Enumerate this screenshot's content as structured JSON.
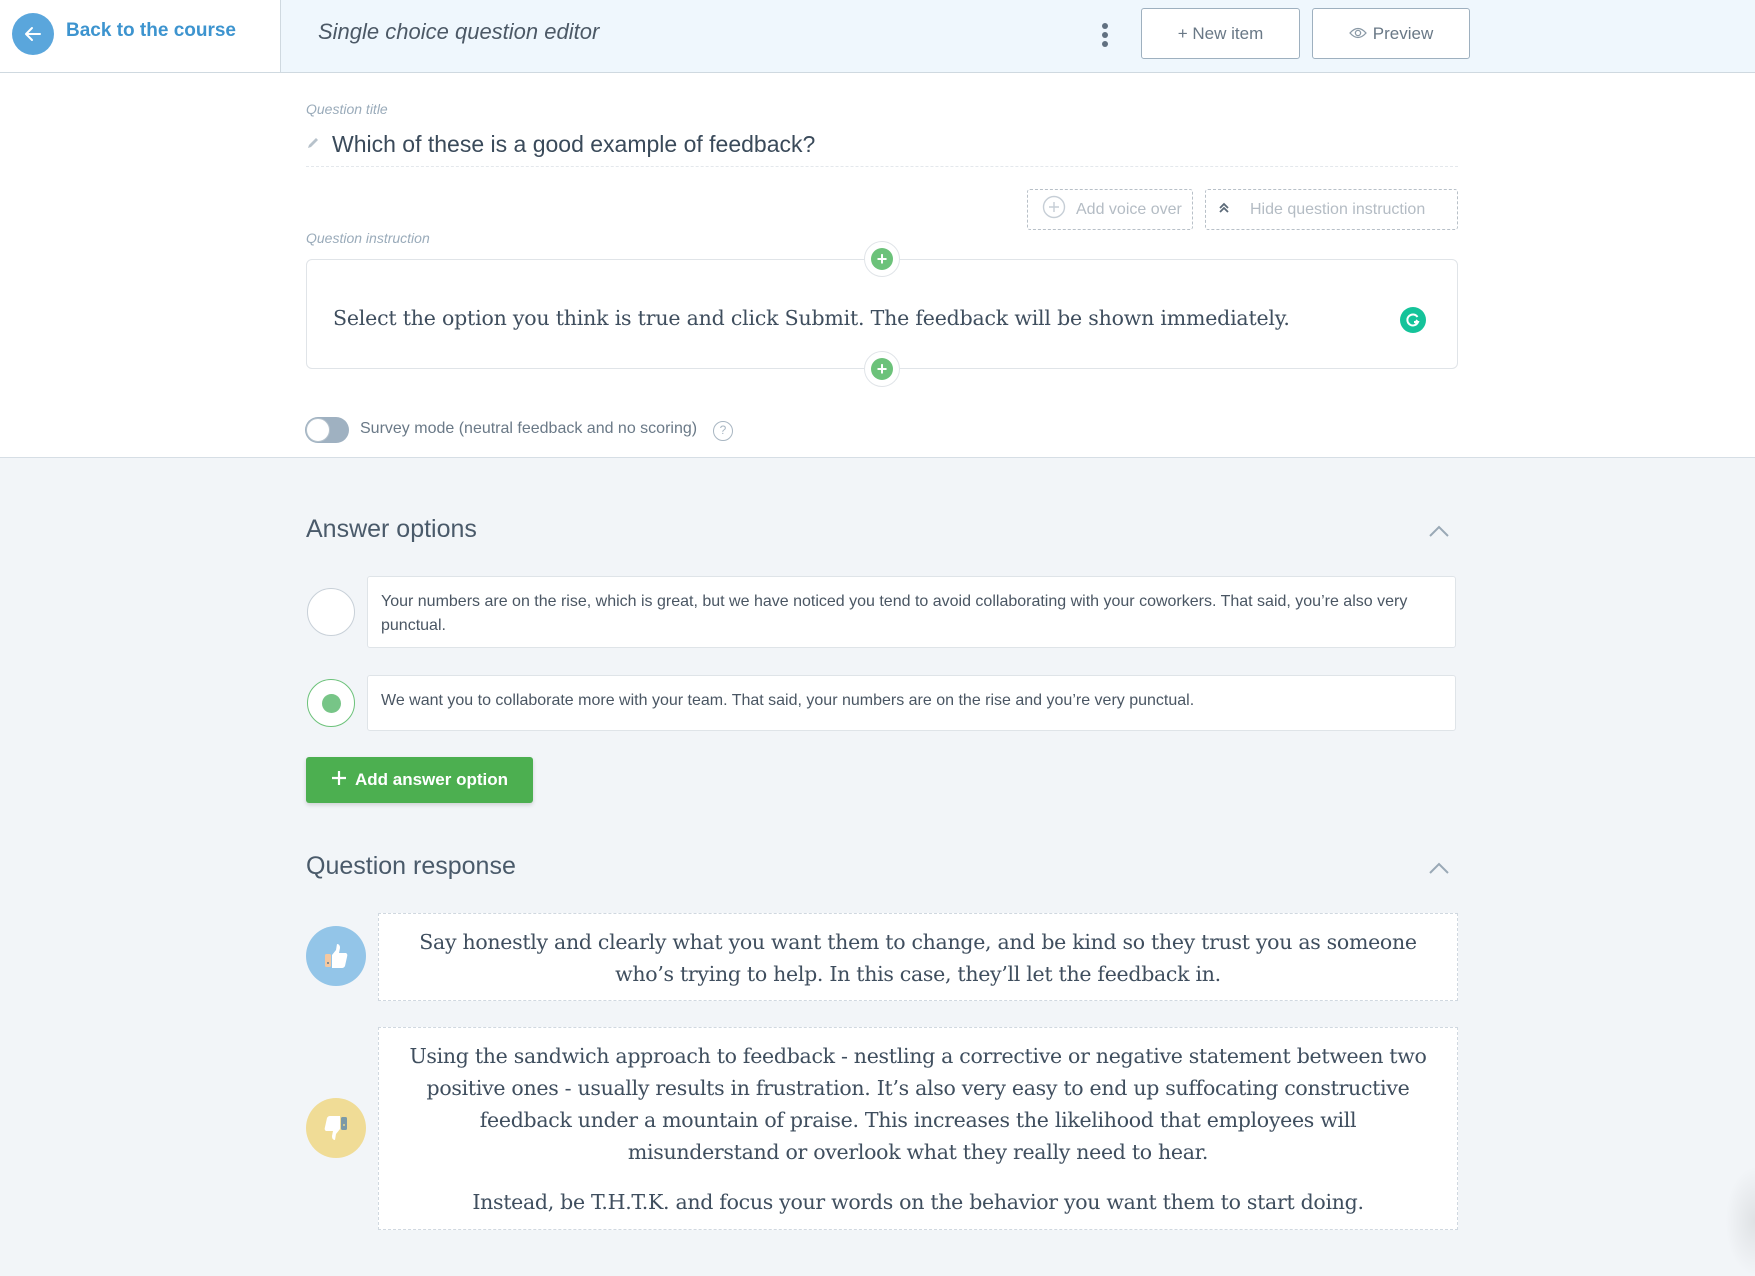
{
  "header": {
    "back_label": "Back to the course",
    "editor_title": "Single choice question editor",
    "new_item_label": "+ New item",
    "preview_label": "Preview"
  },
  "question": {
    "title_label": "Question title",
    "title": "Which of these is a good example of feedback?",
    "add_voice_over_label": "Add voice over",
    "hide_instruction_label": "Hide question instruction",
    "instruction_label": "Question instruction",
    "instruction": "Select the option you think is true and click Submit. The feedback will be shown immediately.",
    "survey_mode_label": "Survey mode (neutral feedback and no scoring)",
    "survey_mode_on": false
  },
  "answer_options": {
    "title": "Answer options",
    "items": [
      {
        "text": "Your numbers are on the rise, which is great, but we have noticed you tend to avoid collaborating with your coworkers. That said, you’re also very punctual.",
        "correct": false
      },
      {
        "text": "We want you to collaborate more with your team. That said, your numbers are on the rise and you’re very punctual.",
        "correct": true
      }
    ],
    "add_label": "Add answer option"
  },
  "question_response": {
    "title": "Question response",
    "correct_feedback": "Say honestly and clearly what you want them to change, and be kind so they trust you as someone who’s trying to help. In this case, they’ll let the feedback in.",
    "incorrect_feedback": [
      "Using the sandwich approach to feedback - nestling a corrective or negative statement between two positive ones - usually results in frustration. It’s also very easy to end up suffocating constructive feedback under a mountain of praise. This increases the likelihood that employees will misunderstand or overlook what they really need to hear.",
      "Instead, be T.H.T.K. and focus your words on the behavior you want them to start doing."
    ]
  },
  "colors": {
    "accent_blue": "#3d94cf",
    "accent_green": "#4caf50",
    "correct_icon_bg": "#93c5e8",
    "incorrect_icon_bg": "#f0dc96"
  }
}
